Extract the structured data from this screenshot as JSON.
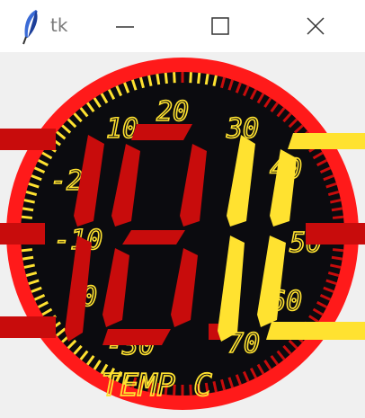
{
  "window": {
    "title": "tk",
    "app_icon": "feather-icon",
    "controls": [
      "minimize-icon",
      "maximize-icon",
      "close-icon"
    ]
  },
  "gauge": {
    "readout": "10.18",
    "label": "TEMP C",
    "scale_labels": [
      "10",
      "20",
      "30",
      "40",
      "50",
      "60",
      "70",
      "-30",
      "-20",
      "-10",
      "0"
    ],
    "colors": {
      "rim": "#ff1a1a",
      "face": "#0b0b0f",
      "segment_red": "#c80c0c",
      "segment_yellow": "#ffe230",
      "text": "#ffe230"
    }
  }
}
